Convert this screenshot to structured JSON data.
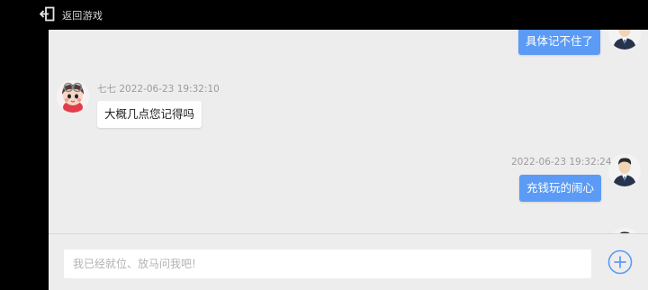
{
  "topbar": {
    "back_label": "返回游戏",
    "back_icon": "exit-arrow-icon"
  },
  "messages": [
    {
      "id": "m1",
      "side": "self",
      "text": "具体记不住了",
      "avatar": "agent-avatar"
    },
    {
      "id": "m2",
      "side": "other",
      "sender": "七七",
      "time": "2022-06-23 19:32:10",
      "text": "大概几点您记得吗",
      "avatar": "user-cartoon-avatar"
    },
    {
      "id": "m3",
      "side": "self",
      "time": "2022-06-23 19:32:24",
      "text": "充钱玩的闹心",
      "avatar": "agent-avatar"
    }
  ],
  "input": {
    "placeholder": "我已经就位、放马问我吧!",
    "value": ""
  },
  "colors": {
    "self_bubble": "#5b9bf5",
    "other_bubble": "#ffffff",
    "chat_bg": "#ededed",
    "topbar_bg": "#000000",
    "add_button": "#5b9bf5"
  }
}
